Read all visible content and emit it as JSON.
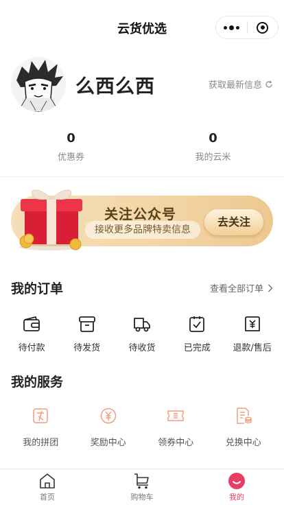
{
  "header": {
    "title": "云货优选",
    "menu_icon": "more-dots-icon",
    "close_icon": "target-close-icon"
  },
  "profile": {
    "username": "么西么西",
    "refresh_text": "获取最新信息",
    "avatar_icon": "manga-avatar-image"
  },
  "stats": [
    {
      "value": "0",
      "label": "优惠券"
    },
    {
      "value": "0",
      "label": "我的云米"
    }
  ],
  "banner": {
    "title": "关注公众号",
    "subtitle": "接收更多品牌特卖信息",
    "button": "去关注",
    "gift_icon": "gift-box-icon"
  },
  "orders": {
    "title": "我的订单",
    "view_all": "查看全部订单",
    "items": [
      {
        "label": "待付款",
        "icon": "wallet-icon"
      },
      {
        "label": "待发货",
        "icon": "box-icon"
      },
      {
        "label": "待收货",
        "icon": "truck-icon"
      },
      {
        "label": "已完成",
        "icon": "clipboard-check-icon"
      },
      {
        "label": "退款/售后",
        "icon": "refund-icon"
      }
    ]
  },
  "services": {
    "title": "我的服务",
    "items": [
      {
        "label": "我的拼团",
        "icon": "group-buy-icon"
      },
      {
        "label": "奖励中心",
        "icon": "reward-icon"
      },
      {
        "label": "领券中心",
        "icon": "coupon-icon"
      },
      {
        "label": "兑换中心",
        "icon": "exchange-icon"
      }
    ]
  },
  "tabbar": {
    "items": [
      {
        "label": "首页",
        "icon": "home-icon"
      },
      {
        "label": "购物车",
        "icon": "cart-icon"
      },
      {
        "label": "我的",
        "icon": "profile-icon",
        "active": true
      }
    ]
  },
  "colors": {
    "accent": "#e83e63",
    "service_icon": "#f39c7c",
    "banner_text": "#5a4218"
  }
}
